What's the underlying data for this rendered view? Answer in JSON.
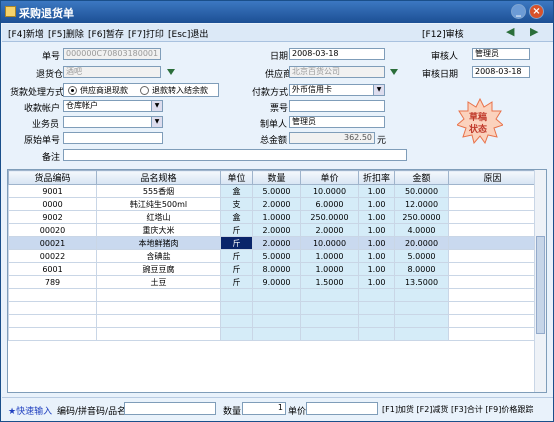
{
  "window": {
    "title": "采购退货单"
  },
  "toolbar": {
    "new": "[F4]新增",
    "delete": "[F5]删除",
    "save_draft": "[F6]暂存",
    "print": "[F7]打印",
    "exit": "[Esc]退出",
    "review": "[F12]审核"
  },
  "form": {
    "doc_no_label": "单号",
    "doc_no": "000000C70803180001",
    "date_label": "日期",
    "date": "2008-03-18",
    "reviewer_label": "审核人",
    "reviewer": "管理员",
    "return_unit_label": "退货仓",
    "return_unit": "酒吧",
    "supplier_label": "供应商",
    "supplier": "北京百货公司",
    "review_date_label": "审核日期",
    "review_date": "2008-03-18",
    "refund_method_label": "货款处理方式",
    "refund_opt1": "供应商退现款",
    "refund_opt2": "退款转入结余款",
    "payment_method_label": "付款方式",
    "payment_method": "外币信用卡",
    "account_label": "收款帐户",
    "account": "仓库帐户",
    "voucher_label": "票号",
    "voucher": "",
    "salesman_label": "业务员",
    "salesman": "",
    "maker_label": "制单人",
    "maker": "管理员",
    "orig_no_label": "原始单号",
    "orig_no": "",
    "total_label": "总金额",
    "total": "362.50",
    "total_unit": "元",
    "remark_label": "备注",
    "remark": "",
    "stamp_line1": "草稿",
    "stamp_line2": "状态"
  },
  "table": {
    "headers": [
      "货品编码",
      "品名规格",
      "单位",
      "数量",
      "单价",
      "折扣率",
      "金额",
      "原因"
    ],
    "rows": [
      [
        "9001",
        "555香烟",
        "盒",
        "5.0000",
        "10.0000",
        "1.00",
        "50.0000",
        ""
      ],
      [
        "0000",
        "韩江纯生500ml",
        "支",
        "2.0000",
        "6.0000",
        "1.00",
        "12.0000",
        ""
      ],
      [
        "9002",
        "红塔山",
        "盒",
        "1.0000",
        "250.0000",
        "1.00",
        "250.0000",
        ""
      ],
      [
        "00020",
        "重庆大米",
        "斤",
        "2.0000",
        "2.0000",
        "1.00",
        "4.0000",
        ""
      ],
      [
        "00021",
        "本地鲜猪肉",
        "斤",
        "2.0000",
        "10.0000",
        "1.00",
        "20.0000",
        ""
      ],
      [
        "00022",
        "含碘盐",
        "斤",
        "5.0000",
        "1.0000",
        "1.00",
        "5.0000",
        ""
      ],
      [
        "6001",
        "豌豆豆腐",
        "斤",
        "8.0000",
        "1.0000",
        "1.00",
        "8.0000",
        ""
      ],
      [
        "789",
        "土豆",
        "斤",
        "9.0000",
        "1.5000",
        "1.00",
        "13.5000",
        ""
      ]
    ]
  },
  "status": {
    "quick_input": "★快速输入",
    "code_label": "编码/拼音码/品名",
    "code": "",
    "qty_label": "数量",
    "qty": "1",
    "price_label": "单价",
    "price": "",
    "keys": "[F1]加货 [F2]减货 [F3]合计 [F9]价格跟踪"
  }
}
